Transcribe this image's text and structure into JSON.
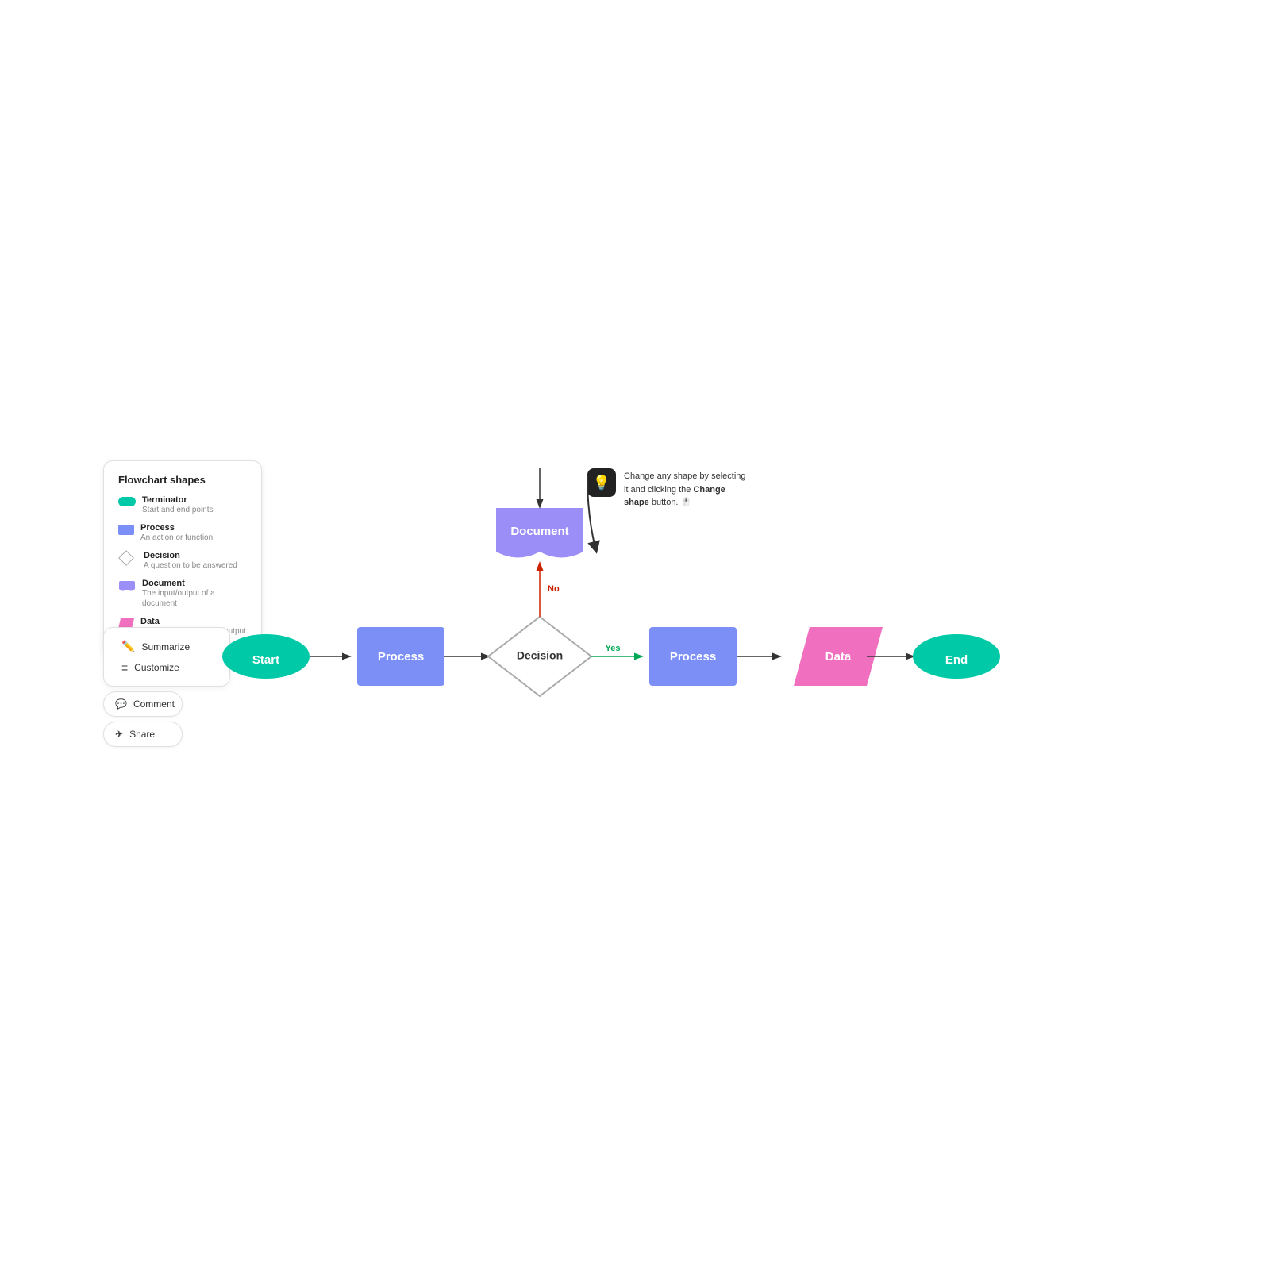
{
  "legend": {
    "title": "Flowchart shapes",
    "items": [
      {
        "id": "terminator",
        "name": "Terminator",
        "desc": "Start and end points",
        "color": "#00c9a7",
        "shape": "oval"
      },
      {
        "id": "process",
        "name": "Process",
        "desc": "An action or function",
        "color": "#7b8ff7",
        "shape": "rect"
      },
      {
        "id": "decision",
        "name": "Decision",
        "desc": "A question to be answered",
        "color": "#ffffff",
        "shape": "diamond"
      },
      {
        "id": "document",
        "name": "Document",
        "desc": "The input/output of a document",
        "color": "#9b8ef7",
        "shape": "document"
      },
      {
        "id": "data",
        "name": "Data",
        "desc": "Data available for input/output",
        "color": "#f06fbe",
        "shape": "parallelogram"
      }
    ]
  },
  "sidebar": {
    "summarize_label": "Summarize",
    "customize_label": "Customize",
    "comment_label": "Comment",
    "share_label": "Share"
  },
  "hint": {
    "icon": "💡",
    "text": "Change any shape by selecting it and clicking the ",
    "bold": "Change shape",
    "text2": " button."
  },
  "flowchart": {
    "nodes": [
      {
        "id": "start",
        "label": "Start",
        "type": "terminator",
        "color": "#00c9a7"
      },
      {
        "id": "process1",
        "label": "Process",
        "type": "process",
        "color": "#7b8ff7"
      },
      {
        "id": "decision",
        "label": "Decision",
        "type": "decision",
        "color": "#ffffff"
      },
      {
        "id": "document",
        "label": "Document",
        "type": "document",
        "color": "#9b8ef7"
      },
      {
        "id": "process2",
        "label": "Process",
        "type": "process",
        "color": "#7b8ff7"
      },
      {
        "id": "data",
        "label": "Data",
        "type": "data",
        "color": "#f06fbe"
      },
      {
        "id": "end",
        "label": "End",
        "type": "terminator",
        "color": "#00c9a7"
      }
    ],
    "yes_label": "Yes",
    "no_label": "No"
  }
}
